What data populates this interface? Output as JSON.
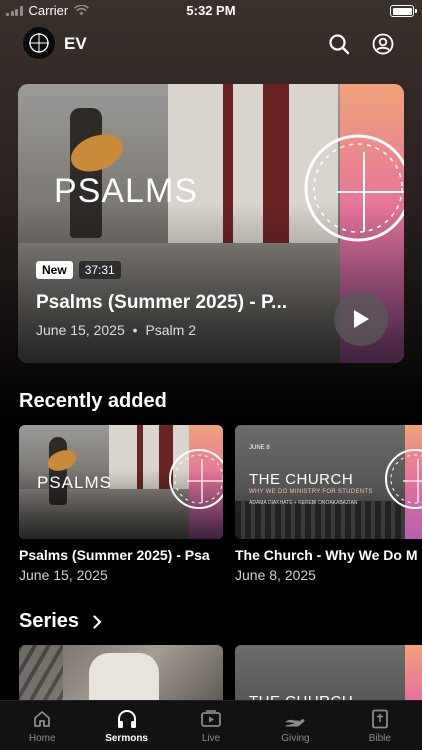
{
  "status_bar": {
    "carrier": "Carrier",
    "time": "5:32 PM"
  },
  "header": {
    "brand": "EV"
  },
  "featured": {
    "artwork_word": "PSALMS",
    "badge_new": "New",
    "duration": "37:31",
    "title": "Psalms (Summer 2025) - P...",
    "date": "June 15, 2025",
    "separator": "•",
    "passage": "Psalm 2"
  },
  "recently_added": {
    "heading": "Recently added",
    "items": [
      {
        "artwork_word": "PSALMS",
        "title": "Psalms (Summer 2025) - Psa",
        "date": "June 15, 2025"
      },
      {
        "artwork_date": "JUNE 8",
        "artwork_word": "THE CHURCH",
        "artwork_subtitle": "WHY WE DO MINISTRY FOR STUDENTS",
        "artwork_speakers": "ADAMA DIAKHATE + KEREBI ONOAKABAZIAN",
        "title": "The Church - Why We Do M",
        "date": "June 8, 2025"
      }
    ]
  },
  "series": {
    "heading": "Series",
    "items": [
      {
        "artwork_word": ""
      },
      {
        "artwork_word": "THE CHURCH"
      }
    ]
  },
  "tabs": [
    {
      "label": "Home",
      "icon": "home-icon"
    },
    {
      "label": "Sermons",
      "icon": "headphones-icon"
    },
    {
      "label": "Live",
      "icon": "live-tv-icon"
    },
    {
      "label": "Giving",
      "icon": "giving-hand-icon"
    },
    {
      "label": "Bible",
      "icon": "bible-icon"
    }
  ],
  "active_tab": "Sermons",
  "colors": {
    "background": "#000000",
    "accent_gradient": [
      "#f0a37b",
      "#e6749a",
      "#b55fb0"
    ]
  }
}
